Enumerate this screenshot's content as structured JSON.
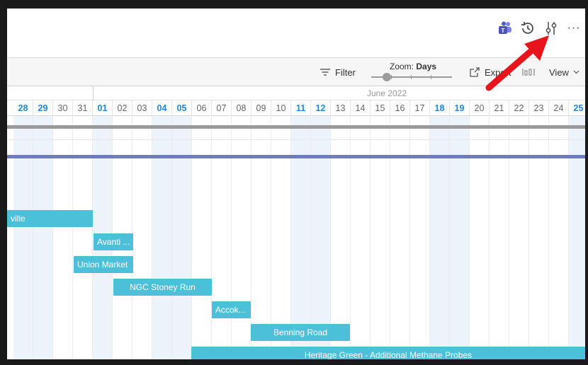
{
  "toolbar": {
    "filter_label": "Filter",
    "zoom_prefix": "Zoom:",
    "zoom_value": "Days",
    "export_label": "Export",
    "view_label": "View"
  },
  "header_icons": [
    "teams-icon",
    "history-icon",
    "settings-sliders-icon",
    "more-icon"
  ],
  "more_label": "···",
  "timeline": {
    "month": "June 2022",
    "days": [
      {
        "d": "28",
        "weekend": true
      },
      {
        "d": "29",
        "weekend": true
      },
      {
        "d": "30",
        "weekend": false
      },
      {
        "d": "31",
        "weekend": false
      },
      {
        "d": "01",
        "weekend": true
      },
      {
        "d": "02",
        "weekend": false
      },
      {
        "d": "03",
        "weekend": false
      },
      {
        "d": "04",
        "weekend": true
      },
      {
        "d": "05",
        "weekend": true
      },
      {
        "d": "06",
        "weekend": false
      },
      {
        "d": "07",
        "weekend": false
      },
      {
        "d": "08",
        "weekend": false
      },
      {
        "d": "09",
        "weekend": false
      },
      {
        "d": "10",
        "weekend": false
      },
      {
        "d": "11",
        "weekend": true
      },
      {
        "d": "12",
        "weekend": true
      },
      {
        "d": "13",
        "weekend": false
      },
      {
        "d": "14",
        "weekend": false
      },
      {
        "d": "15",
        "weekend": false
      },
      {
        "d": "16",
        "weekend": false
      },
      {
        "d": "17",
        "weekend": false
      },
      {
        "d": "18",
        "weekend": true
      },
      {
        "d": "19",
        "weekend": true
      },
      {
        "d": "20",
        "weekend": false
      },
      {
        "d": "21",
        "weekend": false
      },
      {
        "d": "22",
        "weekend": false
      },
      {
        "d": "23",
        "weekend": false
      },
      {
        "d": "24",
        "weekend": false
      },
      {
        "d": "25",
        "weekend": true
      }
    ]
  },
  "tasks": [
    {
      "label": "ville"
    },
    {
      "label": "Avanti ..."
    },
    {
      "label": "Union Market"
    },
    {
      "label": "NGC Stoney Run"
    },
    {
      "label": "Accok..."
    },
    {
      "label": "Benning Road"
    },
    {
      "label": "Heritage Green - Additional Methane Probes"
    }
  ],
  "colors": {
    "task_bar": "#4cc0d8",
    "weekend_text": "#1f88d8",
    "summary_bar_grey": "#9a9a9a",
    "summary_bar_blue": "#6c7bc4",
    "annotation_arrow": "#e8141b"
  }
}
